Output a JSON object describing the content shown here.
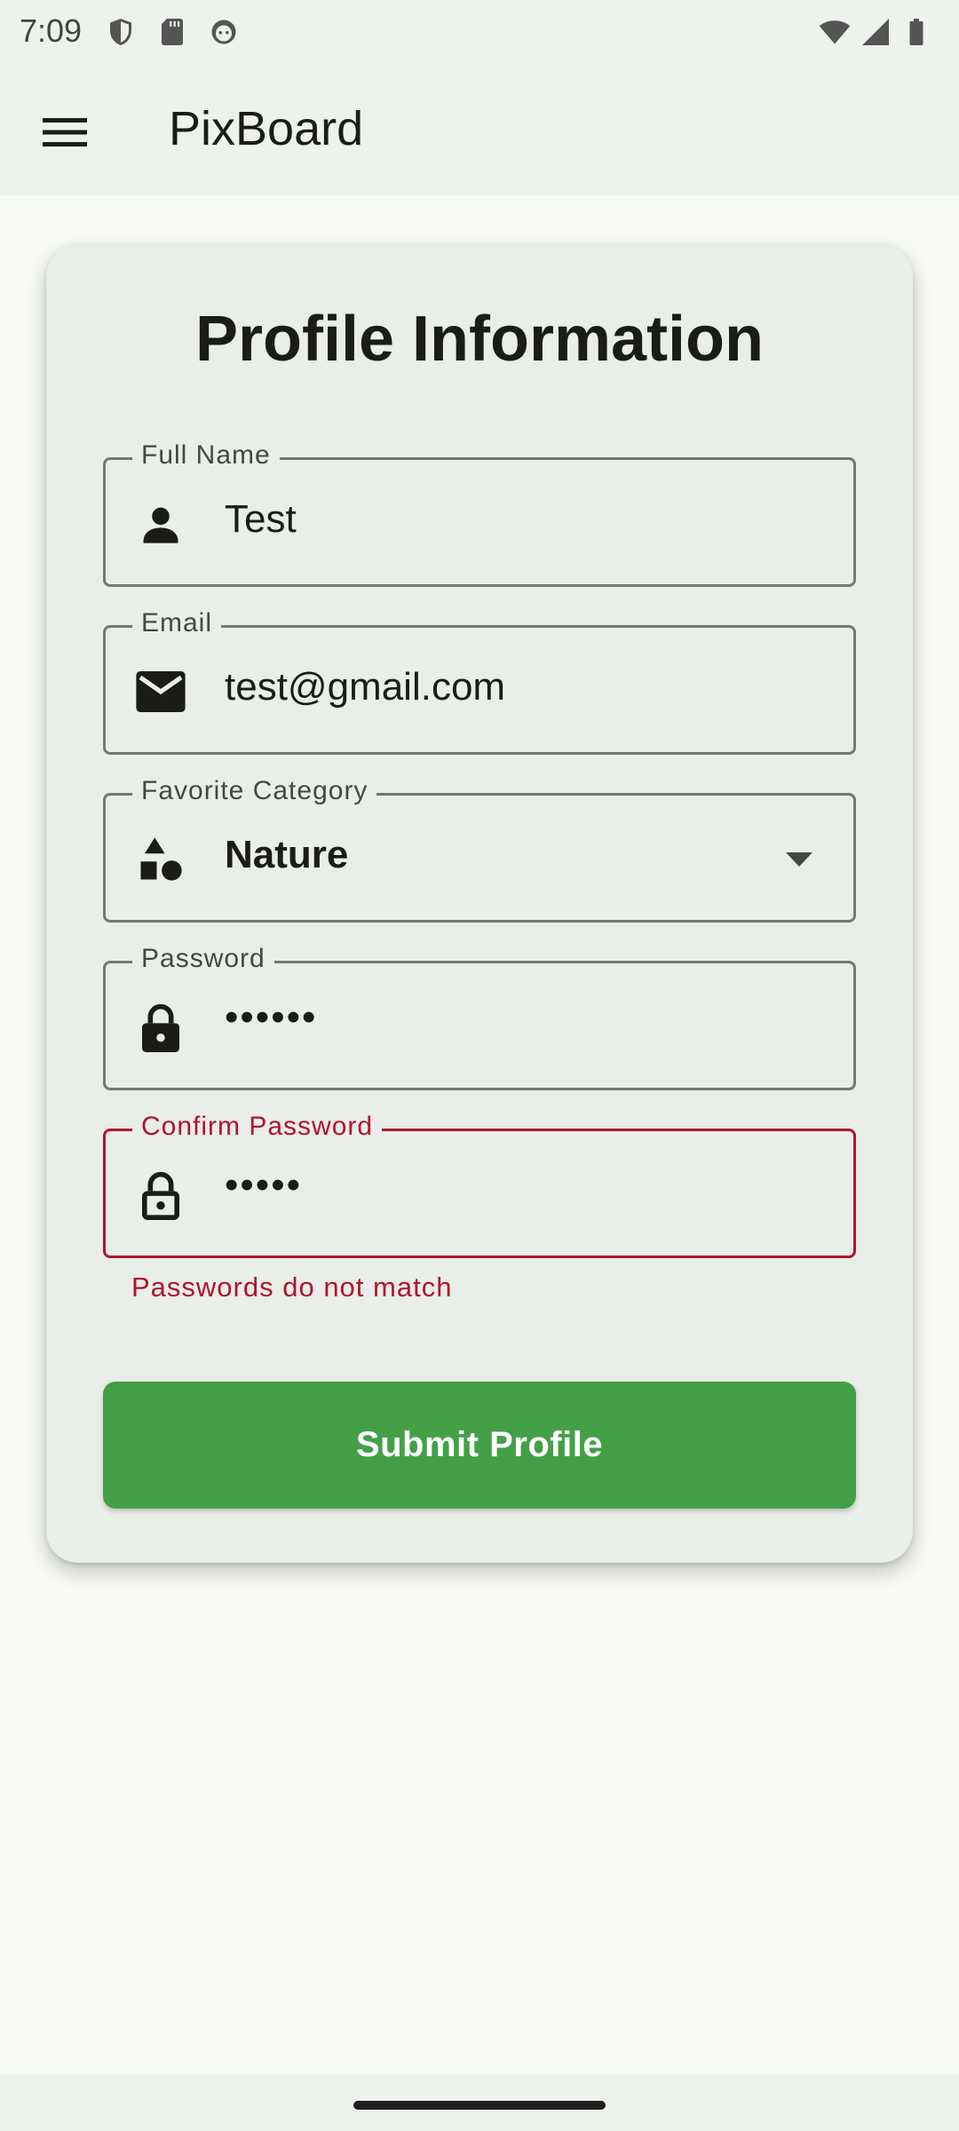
{
  "status_bar": {
    "time": "7:09",
    "left_icons": [
      "shield-icon",
      "sd-card-icon",
      "android-face-icon"
    ],
    "right_icons": [
      "wifi-icon",
      "cell-signal-icon",
      "battery-icon"
    ]
  },
  "app_bar": {
    "title": "PixBoard",
    "menu_icon": "menu-icon"
  },
  "form": {
    "title": "Profile Information",
    "fields": {
      "full_name": {
        "label": "Full Name",
        "value": "Test",
        "icon": "person-icon"
      },
      "email": {
        "label": "Email",
        "value": "test@gmail.com",
        "icon": "mail-icon"
      },
      "category": {
        "label": "Favorite Category",
        "value": "Nature",
        "icon": "category-shapes-icon"
      },
      "password": {
        "label": "Password",
        "value": "••••••",
        "icon": "lock-filled-icon"
      },
      "confirm_password": {
        "label": "Confirm Password",
        "value": "•••••",
        "icon": "lock-outline-icon",
        "error": "Passwords do not match"
      }
    },
    "submit_label": "Submit Profile"
  },
  "colors": {
    "primary_button": "#43a047",
    "error": "#b3132c",
    "card_bg": "#e9eee8",
    "app_bar_bg": "#eef2ec"
  }
}
